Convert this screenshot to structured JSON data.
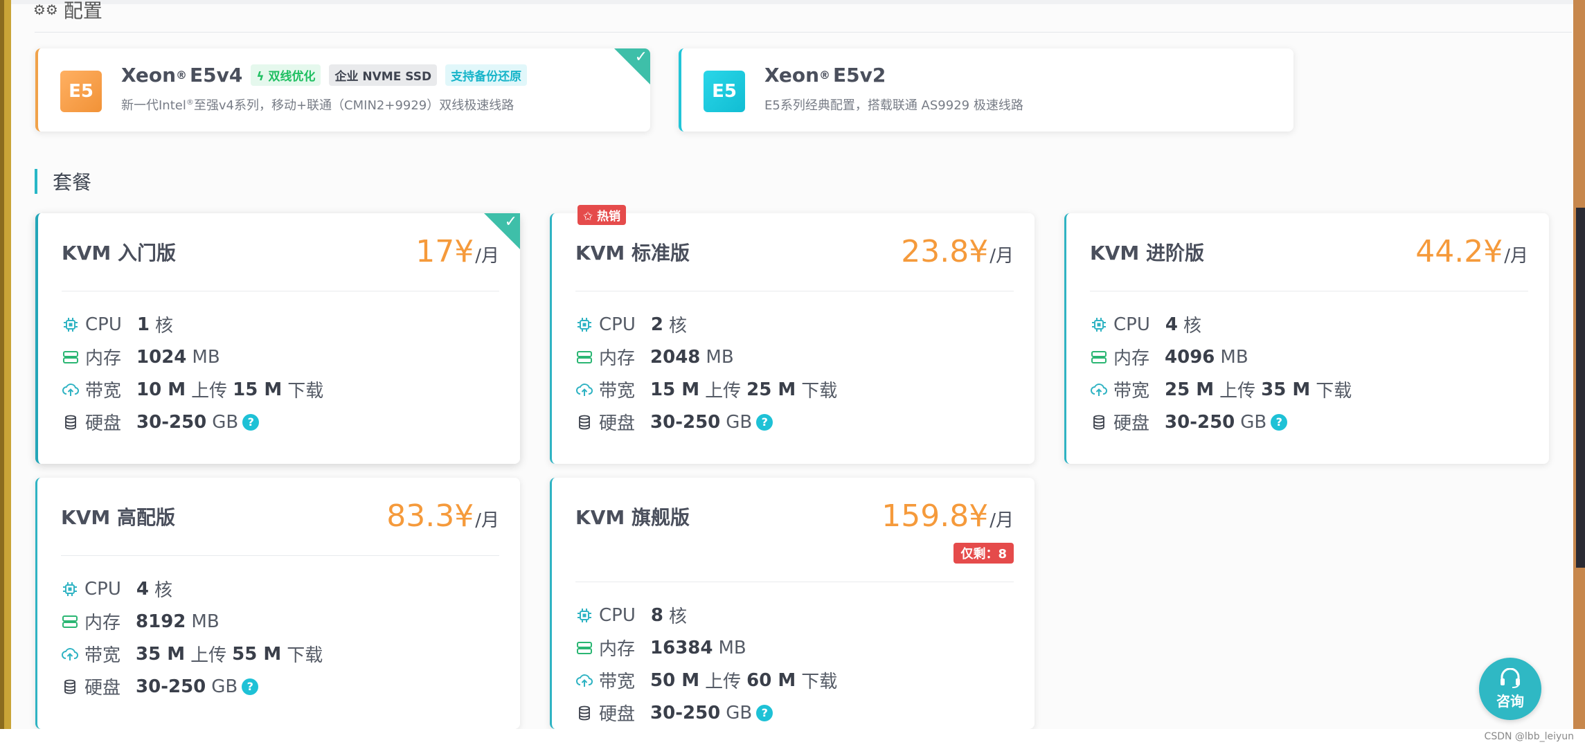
{
  "config_section": {
    "title": "配置"
  },
  "configs": [
    {
      "badge": "E5",
      "name": "Xeon",
      "reg": "®",
      "model": "E5v4",
      "tags": [
        "双线优化",
        "企业 NVME SSD",
        "支持备份还原"
      ],
      "desc_a": "新一代Intel",
      "desc_reg": "®",
      "desc_b": "至强v4系列，移动+联通（CMIN2+9929）双线极速线路",
      "selected": true
    },
    {
      "badge": "E5",
      "name": "Xeon",
      "reg": "®",
      "model": "E5v2",
      "tags": [],
      "desc_a": "E5系列经典配置，搭载联通 AS9929 极速线路",
      "desc_reg": "",
      "desc_b": "",
      "selected": false
    }
  ],
  "package_section": {
    "title": "套餐"
  },
  "labels": {
    "cpu": "CPU",
    "mem": "内存",
    "bw": "带宽",
    "disk": "硬盘",
    "core_unit": "核",
    "mem_unit": "MB",
    "up": "上传",
    "down": "下载",
    "disk_unit": "GB",
    "month": "/月",
    "help": "?"
  },
  "plans": [
    {
      "name": "KVM 入门版",
      "price": "17¥",
      "cpu": "1",
      "mem": "1024",
      "up": "10 M",
      "down": "15 M",
      "disk": "30-250",
      "selected": true
    },
    {
      "name": "KVM 标准版",
      "price": "23.8¥",
      "cpu": "2",
      "mem": "2048",
      "up": "15 M",
      "down": "25 M",
      "disk": "30-250",
      "hot": "✩ 热销"
    },
    {
      "name": "KVM 进阶版",
      "price": "44.2¥",
      "cpu": "4",
      "mem": "4096",
      "up": "25 M",
      "down": "35 M",
      "disk": "30-250"
    },
    {
      "name": "KVM 高配版",
      "price": "83.3¥",
      "cpu": "4",
      "mem": "8192",
      "up": "35 M",
      "down": "55 M",
      "disk": "30-250"
    },
    {
      "name": "KVM 旗舰版",
      "price": "159.8¥",
      "cpu": "8",
      "mem": "16384",
      "up": "50 M",
      "down": "60 M",
      "disk": "30-250",
      "stock": "仅剩：8"
    }
  ],
  "consult": {
    "label": "咨询"
  },
  "watermark": "CSDN @lbb_leiyun",
  "colors": {
    "accent": "#2fb8c4",
    "price": "#f59a3b",
    "hot": "#e54b4b",
    "check": "#3ebfa9"
  },
  "icons": [
    "config-icon",
    "check-icon",
    "bolt-icon",
    "cpu-icon",
    "memory-icon",
    "upload-cloud-icon",
    "disk-icon",
    "headset-icon"
  ]
}
